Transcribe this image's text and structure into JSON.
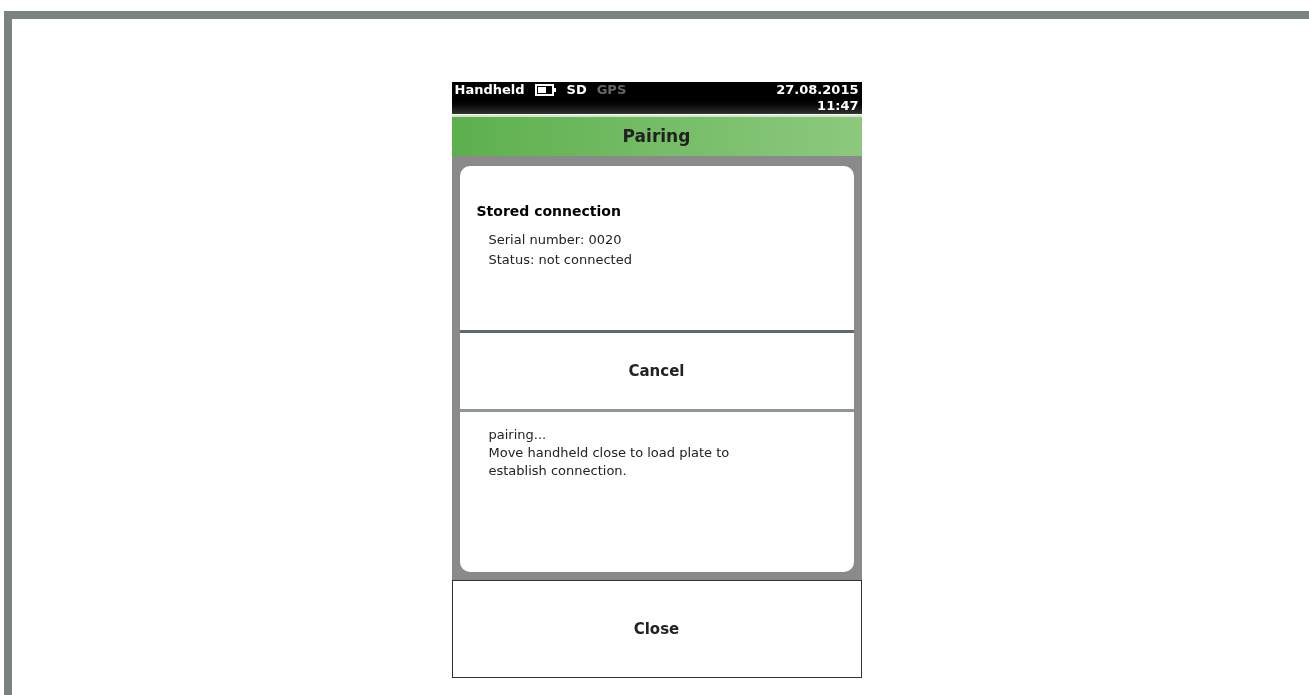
{
  "status_bar": {
    "device": "Handheld",
    "indicators": [
      {
        "label": "SD",
        "active": true
      },
      {
        "label": "GPS",
        "active": false
      }
    ],
    "date": "27.08.2015",
    "time": "11:47"
  },
  "title": "Pairing",
  "stored_connection": {
    "heading": "Stored connection",
    "lines": [
      "Serial number: 0020",
      "Status: not connected"
    ]
  },
  "cancel_button": "Cancel",
  "message": [
    "pairing...",
    "Move handheld close to load plate to establish connection."
  ],
  "close_button": "Close"
}
